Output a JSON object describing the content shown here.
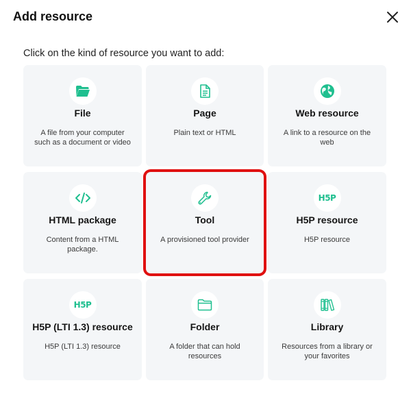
{
  "dialog": {
    "title": "Add resource",
    "close_icon": "close-icon",
    "instruction": "Click on the kind of resource you want to add:"
  },
  "accent_color": "#1fbf8f",
  "highlight_color": "#e01010",
  "cards": [
    {
      "icon": "folder-open-icon",
      "title": "File",
      "description": "A file from your computer such as a document or video"
    },
    {
      "icon": "page-icon",
      "title": "Page",
      "description": "Plain text or HTML"
    },
    {
      "icon": "globe-icon",
      "title": "Web resource",
      "description": "A link to a resource on the web"
    },
    {
      "icon": "code-icon",
      "title": "HTML package",
      "description": "Content from a HTML package."
    },
    {
      "icon": "wrench-icon",
      "title": "Tool",
      "description": "A provisioned tool provider",
      "highlighted": true
    },
    {
      "icon": "h5p-icon",
      "icon_text": "H5P",
      "title": "H5P resource",
      "description": "H5P resource"
    },
    {
      "icon": "h5p-icon",
      "icon_text": "H5P",
      "title": "H5P (LTI 1.3) resource",
      "description": "H5P (LTI 1.3) resource"
    },
    {
      "icon": "folder-icon",
      "title": "Folder",
      "description": "A folder that can hold resources"
    },
    {
      "icon": "library-icon",
      "title": "Library",
      "description": "Resources from a library or your favorites"
    }
  ]
}
